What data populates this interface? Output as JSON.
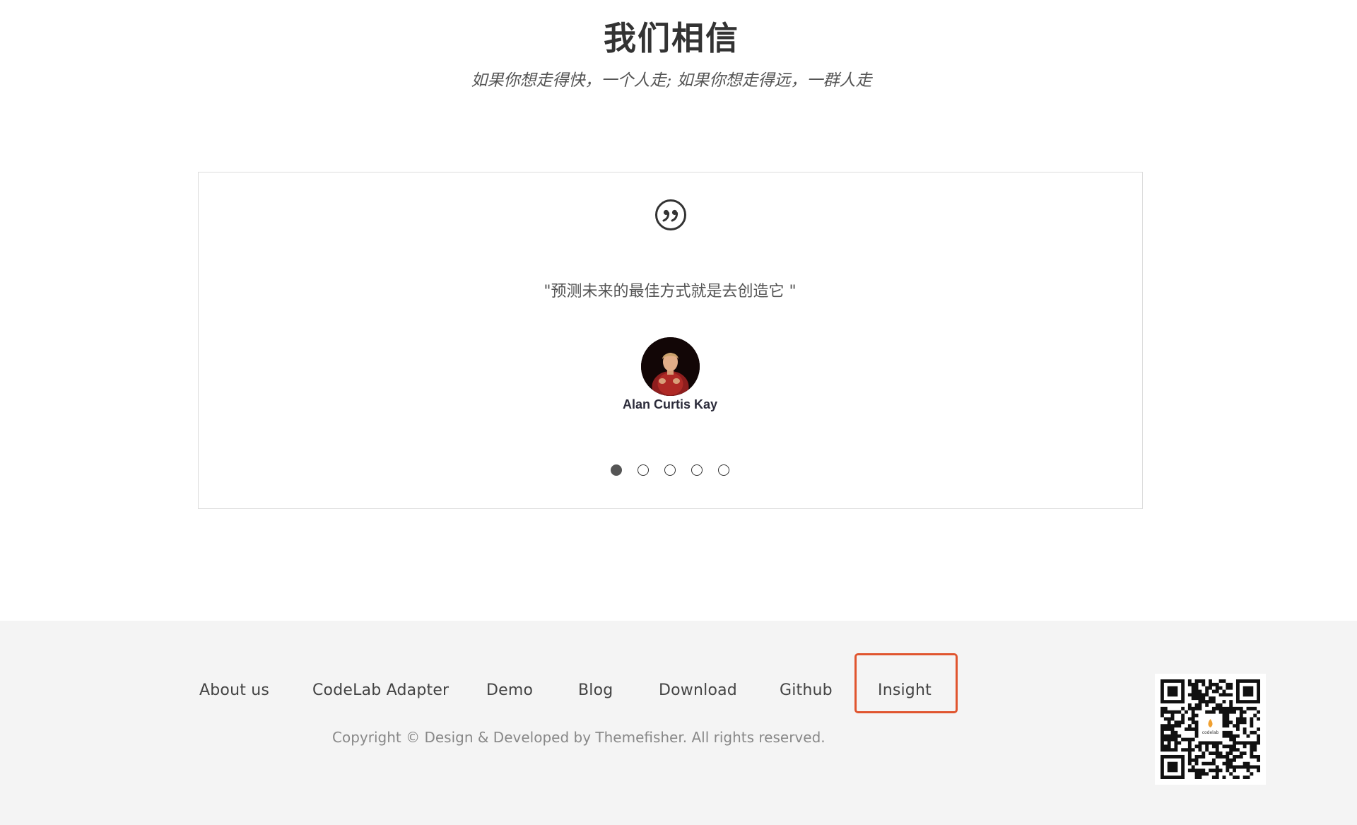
{
  "hero": {
    "title": "我们相信",
    "subtitle": "如果你想走得快，一个人走; 如果你想走得远，一群人走"
  },
  "testimonial": {
    "quote_icon": "quote-icon",
    "quote": "\"预测未来的最佳方式就是去创造它 \"",
    "author": "Alan Curtis Kay",
    "slides_total": 5,
    "active_slide": 1
  },
  "footer": {
    "nav": [
      {
        "label": "About us"
      },
      {
        "label": "CodeLab Adapter"
      },
      {
        "label": "Demo"
      },
      {
        "label": "Blog"
      },
      {
        "label": "Download"
      },
      {
        "label": "Github"
      },
      {
        "label": "Insight"
      }
    ],
    "highlighted_item": "Insight",
    "highlight_color": "#e0552f",
    "copyright": "Copyright © Design & Developed by Themefisher. All rights reserved.",
    "qr_icon": "qr-code-icon",
    "qr_logo_text": "codelab"
  }
}
